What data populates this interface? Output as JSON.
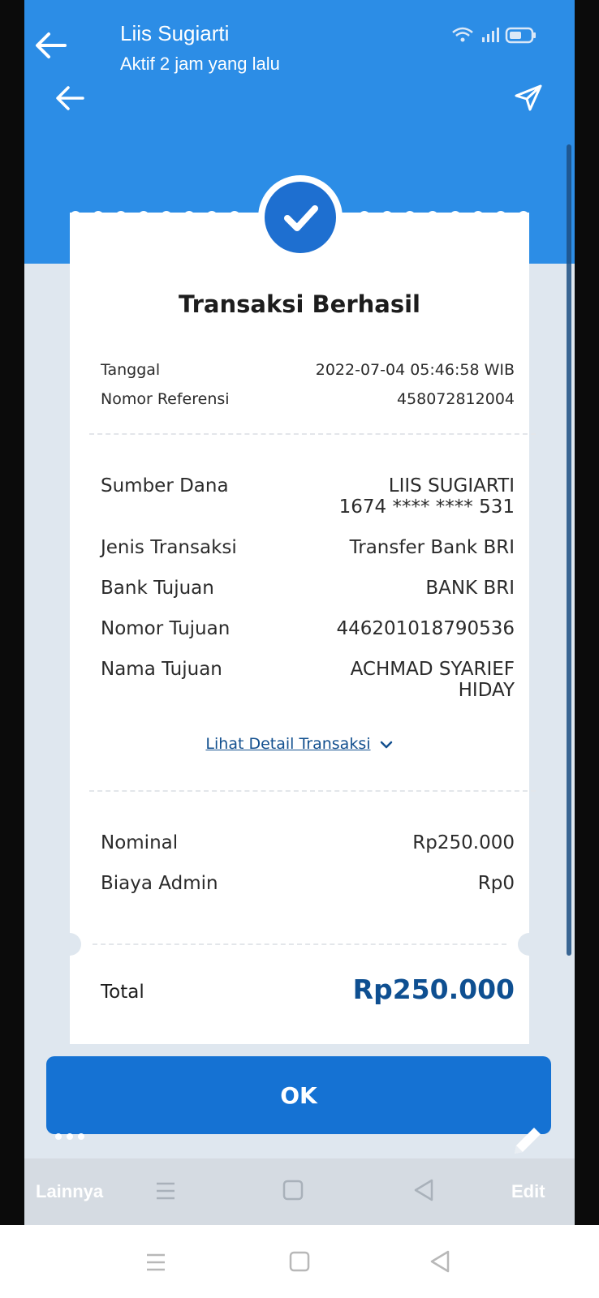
{
  "chat_header": {
    "contact_name": "Liis Sugiarti",
    "status": "Aktif 2 jam yang lalu"
  },
  "receipt": {
    "title": "Transaksi Berhasil",
    "meta": [
      {
        "label": "Tanggal",
        "value": "2022-07-04 05:46:58 WIB"
      },
      {
        "label": "Nomor Referensi",
        "value": "458072812004"
      }
    ],
    "details": {
      "sumber_dana_label": "Sumber Dana",
      "sumber_dana_name": "LIIS SUGIARTI",
      "sumber_dana_account": "1674 **** **** 531",
      "jenis_label": "Jenis Transaksi",
      "jenis_value": "Transfer Bank BRI",
      "bank_label": "Bank Tujuan",
      "bank_value": "BANK BRI",
      "nomor_label": "Nomor Tujuan",
      "nomor_value": "446201018790536",
      "nama_label": "Nama Tujuan",
      "nama_value_line1": "ACHMAD SYARIEF",
      "nama_value_line2": "HIDAY"
    },
    "detail_link": "Lihat Detail Transaksi",
    "amounts": [
      {
        "label": "Nominal",
        "value": "Rp250.000"
      },
      {
        "label": "Biaya Admin",
        "value": "Rp0"
      }
    ],
    "total_label": "Total",
    "total_value": "Rp250.000",
    "ok_label": "OK"
  },
  "viewer_toolbar": {
    "more_label": "Lainnya",
    "edit_label": "Edit"
  },
  "colors": {
    "header_blue": "#2c8de6",
    "button_blue": "#1572d3",
    "total_blue": "#0e4f91",
    "link_blue": "#13508f"
  },
  "icons": [
    "back-arrow-icon",
    "send-icon",
    "check-icon",
    "chevron-down-icon",
    "more-dots-icon",
    "pencil-icon",
    "menu-icon",
    "home-icon",
    "back-triangle-icon",
    "wifi-icon",
    "signal-icon",
    "battery-icon"
  ]
}
